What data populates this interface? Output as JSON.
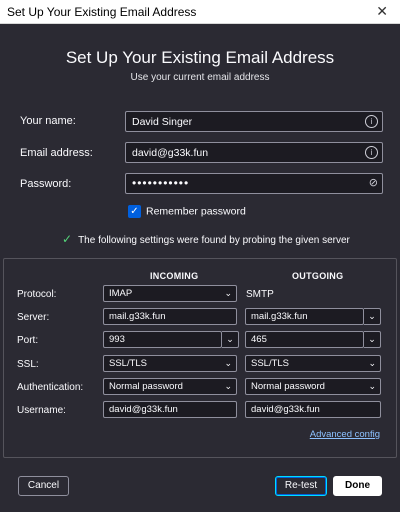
{
  "window": {
    "title": "Set Up Your Existing Email Address",
    "close_icon": "close-icon"
  },
  "header": {
    "title": "Set Up Your Existing Email Address",
    "subtitle": "Use your current email address"
  },
  "form": {
    "name_label": "Your name:",
    "name_value": "David Singer",
    "email_label": "Email address:",
    "email_value": "david@g33k.fun",
    "password_label": "Password:",
    "password_value": "•••••••••••",
    "remember_label": "Remember password",
    "remember_checked": true
  },
  "status": {
    "found_text": "The following settings were found by probing the given server",
    "color": "#55d67a"
  },
  "config": {
    "incoming_header": "INCOMING",
    "outgoing_header": "OUTGOING",
    "rows": {
      "protocol": {
        "label": "Protocol:",
        "incoming": "IMAP",
        "outgoing": "SMTP"
      },
      "server": {
        "label": "Server:",
        "incoming": "mail.g33k.fun",
        "outgoing": "mail.g33k.fun"
      },
      "port": {
        "label": "Port:",
        "incoming": "993",
        "outgoing": "465"
      },
      "ssl": {
        "label": "SSL:",
        "incoming": "SSL/TLS",
        "outgoing": "SSL/TLS"
      },
      "auth": {
        "label": "Authentication:",
        "incoming": "Normal password",
        "outgoing": "Normal password"
      },
      "username": {
        "label": "Username:",
        "incoming": "david@g33k.fun",
        "outgoing": "david@g33k.fun"
      }
    },
    "advanced_link": "Advanced config"
  },
  "buttons": {
    "cancel": "Cancel",
    "retest": "Re-test",
    "done": "Done"
  },
  "colors": {
    "background": "#2b2a33",
    "field_bg": "#1c1b22",
    "link": "#8cc1ff",
    "accent": "#0060df"
  }
}
